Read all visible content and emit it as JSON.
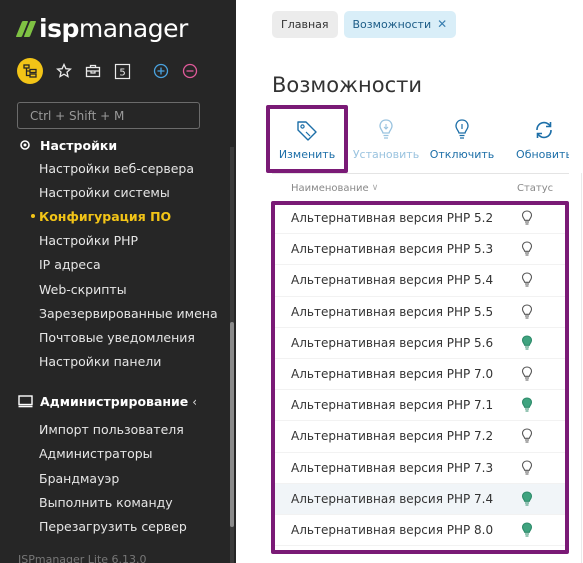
{
  "logo": {
    "bold": "isp",
    "regular": "manager"
  },
  "quick": {
    "icons": [
      "tree-structure-icon",
      "star-icon",
      "briefcase-icon",
      "number-badge-icon",
      "plus-circle-icon",
      "minus-circle-icon"
    ],
    "number_badge": "5"
  },
  "search": {
    "placeholder": "Ctrl + Shift + M"
  },
  "sidebar": {
    "settings_section": "Настройки",
    "settings_items": [
      "Настройки веб-сервера",
      "Настройки системы",
      "Конфигурация ПО",
      "Настройки PHP",
      "IP адреса",
      "Web-скрипты",
      "Зарезервированные имена",
      "Почтовые уведомления",
      "Настройки панели"
    ],
    "admin_section": "Администрирование",
    "admin_chevron": "‹",
    "admin_items": [
      "Импорт пользователя",
      "Администраторы",
      "Брандмауэр",
      "Выполнить команду",
      "Перезагрузить сервер"
    ],
    "footer": "ISPmanager Lite 6.13.0"
  },
  "breadcrumbs": {
    "home": "Главная",
    "current": "Возможности"
  },
  "page_title": "Возможности",
  "toolbar": {
    "edit": "Изменить",
    "install": "Установить",
    "disable": "Отключить",
    "refresh": "Обновить"
  },
  "table": {
    "col_name": "Наименование",
    "col_status": "Статус",
    "rows": [
      {
        "name": "Альтернативная версия PHP 5.2",
        "status": "off"
      },
      {
        "name": "Альтернативная версия PHP 5.3",
        "status": "off"
      },
      {
        "name": "Альтернативная версия PHP 5.4",
        "status": "off"
      },
      {
        "name": "Альтернативная версия PHP 5.5",
        "status": "off"
      },
      {
        "name": "Альтернативная версия PHP 5.6",
        "status": "on"
      },
      {
        "name": "Альтернативная версия PHP 7.0",
        "status": "off"
      },
      {
        "name": "Альтернативная версия PHP 7.1",
        "status": "on"
      },
      {
        "name": "Альтернативная версия PHP 7.2",
        "status": "off"
      },
      {
        "name": "Альтернативная версия PHP 7.3",
        "status": "off"
      },
      {
        "name": "Альтернативная версия PHP 7.4",
        "status": "on"
      },
      {
        "name": "Альтернативная версия PHP 8.0",
        "status": "on"
      }
    ]
  },
  "colors": {
    "sidebar_bg": "#262626",
    "accent_yellow": "#f2c417",
    "link_blue": "#1d6fa8",
    "status_on": "#2e8b6a",
    "highlight_purple": "#7a1a76"
  }
}
